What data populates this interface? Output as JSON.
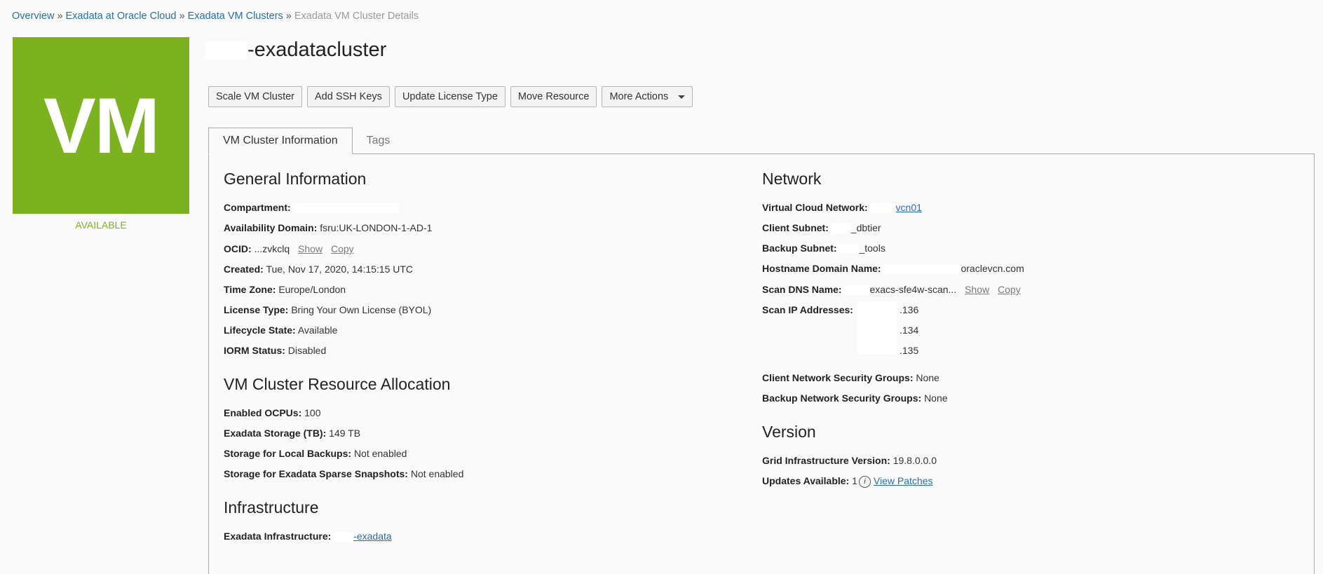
{
  "breadcrumb": {
    "items": [
      "Overview",
      "Exadata at Oracle Cloud",
      "Exadata VM Clusters"
    ],
    "current": "Exadata VM Cluster Details",
    "separator": "»"
  },
  "tile": {
    "label": "VM",
    "status": "AVAILABLE",
    "color": "#7cb21f"
  },
  "page": {
    "title": "-exadatacluster"
  },
  "toolbar": {
    "scale": "Scale VM Cluster",
    "ssh": "Add SSH Keys",
    "license": "Update License Type",
    "move": "Move Resource",
    "more": "More Actions"
  },
  "tabs": {
    "info": "VM Cluster Information",
    "tags": "Tags"
  },
  "general": {
    "heading": "General Information",
    "compartment_label": "Compartment:",
    "ad_label": "Availability Domain:",
    "ad_value": "fsru:UK-LONDON-1-AD-1",
    "ocid_label": "OCID:",
    "ocid_value": "...zvkclq",
    "show": "Show",
    "copy": "Copy",
    "created_label": "Created:",
    "created_value": "Tue, Nov 17, 2020, 14:15:15 UTC",
    "tz_label": "Time Zone:",
    "tz_value": "Europe/London",
    "lt_label": "License Type:",
    "lt_value": "Bring Your Own License (BYOL)",
    "ls_label": "Lifecycle State:",
    "ls_value": "Available",
    "iorm_label": "IORM Status:",
    "iorm_value": "Disabled"
  },
  "allocation": {
    "heading": "VM Cluster Resource Allocation",
    "ocpu_label": "Enabled OCPUs:",
    "ocpu_value": "100",
    "storage_label": "Exadata Storage (TB):",
    "storage_value": "149 TB",
    "local_label": "Storage for Local Backups:",
    "local_value": "Not enabled",
    "sparse_label": "Storage for Exadata Sparse Snapshots:",
    "sparse_value": "Not enabled"
  },
  "infrastructure": {
    "heading": "Infrastructure",
    "label": "Exadata Infrastructure:",
    "value": "-exadata"
  },
  "network": {
    "heading": "Network",
    "vcn_label": "Virtual Cloud Network:",
    "vcn_value": "vcn01",
    "client_label": "Client Subnet:",
    "client_value": "_dbtier",
    "backup_label": "Backup Subnet:",
    "backup_value": "_tools",
    "hdn_label": "Hostname Domain Name:",
    "hdn_value": "oraclevcn.com",
    "scan_label": "Scan DNS Name:",
    "scan_value": "exacs-sfe4w-scan...",
    "show": "Show",
    "copy": "Copy",
    "ip_label": "Scan IP Addresses:",
    "ips": [
      ".136",
      ".134",
      ".135"
    ],
    "cnsg_label": "Client Network Security Groups:",
    "cnsg_value": "None",
    "bnsg_label": "Backup Network Security Groups:",
    "bnsg_value": "None"
  },
  "version": {
    "heading": "Version",
    "giv_label": "Grid Infrastructure Version:",
    "giv_value": "19.8.0.0.0",
    "ua_label": "Updates Available:",
    "ua_value": "1",
    "info_glyph": "i",
    "patches": "View Patches"
  }
}
